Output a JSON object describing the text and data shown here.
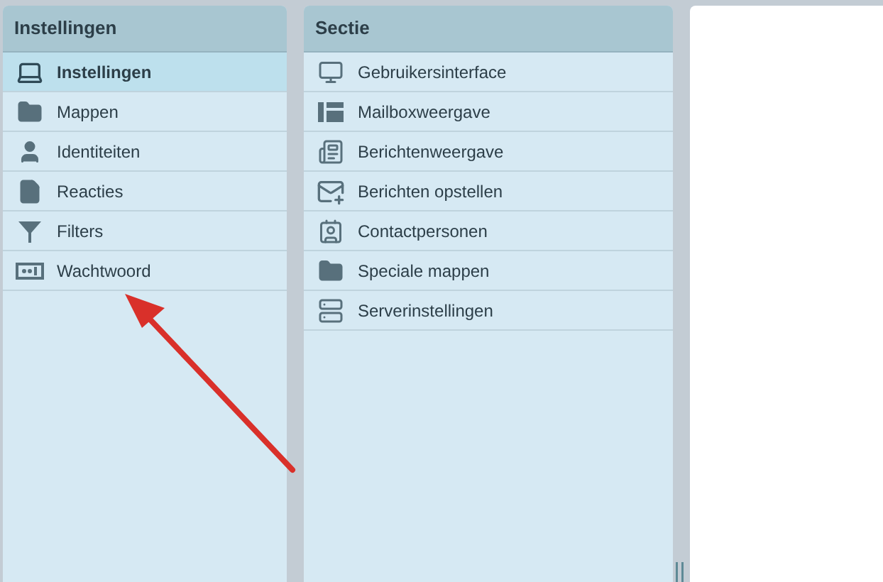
{
  "settings_panel": {
    "title": "Instellingen",
    "items": [
      {
        "label": "Instellingen",
        "selected": true
      },
      {
        "label": "Mappen",
        "selected": false
      },
      {
        "label": "Identiteiten",
        "selected": false
      },
      {
        "label": "Reacties",
        "selected": false
      },
      {
        "label": "Filters",
        "selected": false
      },
      {
        "label": "Wachtwoord",
        "selected": false
      }
    ]
  },
  "section_panel": {
    "title": "Sectie",
    "items": [
      {
        "label": "Gebruikersinterface",
        "selected": false
      },
      {
        "label": "Mailboxweergave",
        "selected": false
      },
      {
        "label": "Berichtenweergave",
        "selected": false
      },
      {
        "label": "Berichten opstellen",
        "selected": false
      },
      {
        "label": "Contactpersonen",
        "selected": false
      },
      {
        "label": "Speciale mappen",
        "selected": false
      },
      {
        "label": "Serverinstellingen",
        "selected": false
      }
    ]
  }
}
